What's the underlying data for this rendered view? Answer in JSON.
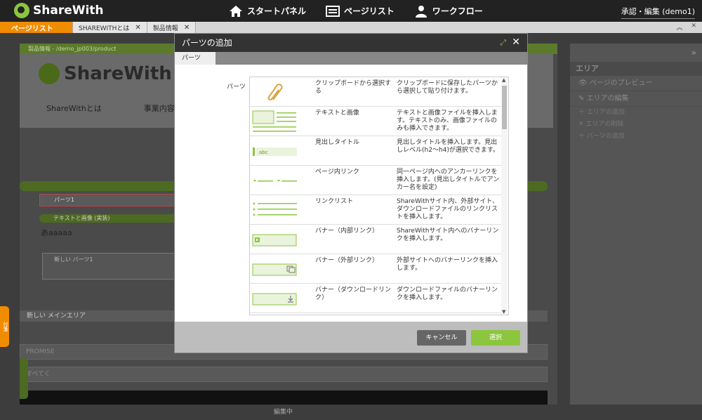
{
  "app": {
    "logo_text": "ShareWith"
  },
  "topnav": [
    {
      "label": "スタートパネル",
      "icon": "home-icon"
    },
    {
      "label": "ページリスト",
      "icon": "page-list-icon"
    },
    {
      "label": "ワークフロー",
      "icon": "person-icon"
    }
  ],
  "user_menu": {
    "label": "承認・編集 (demo1)"
  },
  "tabs": [
    {
      "label": "ページリスト",
      "active": true
    },
    {
      "label": "SHAREWITHとは",
      "close": "✕"
    },
    {
      "label": "製品情報",
      "close": "✕"
    }
  ],
  "background": {
    "breadcrumb": "製品情報 - /demo_jp003/product",
    "logo_text": "ShareWith",
    "nav": [
      "ShareWithとは",
      "事業内容"
    ],
    "part_box": "パーツ1",
    "part_label": "テキストと画像 (実装)",
    "text_sample": "あaaaaa",
    "new_part": "新しい パーツ1",
    "main_area": "新しい メインエリア",
    "input1": "PROMISE",
    "input2": "すべてく",
    "status": "編集中",
    "side_tab": "付箋"
  },
  "right_panel": {
    "header": "エリア",
    "items": [
      "ページのプレビュー",
      "エリアの編集"
    ],
    "small_items": [
      "エリアの追加",
      "エリアの削除",
      "パーツの追加"
    ]
  },
  "modal": {
    "title": "パーツの追加",
    "tab": "パーツ",
    "parts_label": "パーツ",
    "parts": [
      {
        "name": "クリップボードから選択する",
        "desc": "クリップボードに保存したパーツから選択して貼り付けます。",
        "icon": "paperclip-icon"
      },
      {
        "name": "テキストと画像",
        "desc": "テキストと画像ファイルを挿入します。テキストのみ、画像ファイルのみも挿入できます。",
        "icon": "text-image-icon"
      },
      {
        "name": "見出しタイトル",
        "desc": "見出しタイトルを挿入します。見出しレベル(h2〜h4)が選択できます。",
        "icon": "heading-icon",
        "thumb_text": "abc"
      },
      {
        "name": "ページ内リンク",
        "desc": "同一ページ内へのアンカーリンクを挿入します。(見出しタイトルでアンカー名を設定)",
        "icon": "anchor-link-icon"
      },
      {
        "name": "リンクリスト",
        "desc": "ShareWithサイト内、外部サイト、ダウンロードファイルのリンクリストを挿入します。",
        "icon": "link-list-icon"
      },
      {
        "name": "バナー（内部リンク）",
        "desc": "ShareWithサイト内へのバナーリンクを挿入します。",
        "icon": "banner-internal-icon"
      },
      {
        "name": "バナー（外部リンク）",
        "desc": "外部サイトへのバナーリンクを挿入します。",
        "icon": "banner-external-icon"
      },
      {
        "name": "バナー（ダウンロードリンク）",
        "desc": "ダウンロードファイルのバナーリンクを挿入します。",
        "icon": "banner-download-icon"
      }
    ],
    "cancel_label": "キャンセル",
    "select_label": "選択"
  },
  "colors": {
    "accent": "#8cc63f",
    "orange": "#f08c00",
    "dark": "#222222"
  }
}
